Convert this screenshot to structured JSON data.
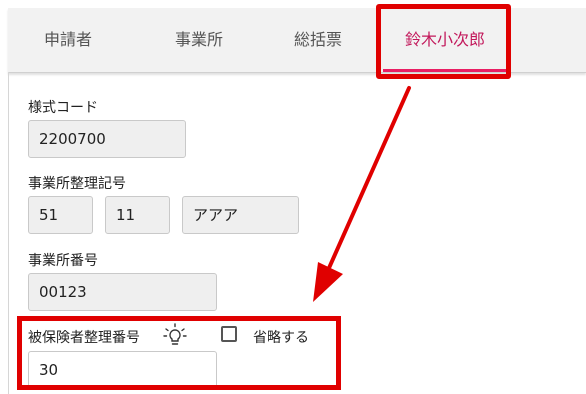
{
  "tabs": [
    {
      "label": "申請者"
    },
    {
      "label": "事業所"
    },
    {
      "label": "総括票"
    },
    {
      "label": "鈴木小次郎",
      "active": true
    }
  ],
  "form": {
    "style_code": {
      "label": "様式コード",
      "value": "2200700"
    },
    "office_ref": {
      "label": "事業所整理記号",
      "values": [
        "51",
        "11",
        "アアア"
      ]
    },
    "office_number": {
      "label": "事業所番号",
      "value": "00123"
    },
    "insured_ref": {
      "label": "被保険者整理番号",
      "value": "30",
      "hint_icon": "lightbulb-icon"
    },
    "omit": {
      "label": "省略する",
      "checked": false
    }
  },
  "annotation": {
    "color": "#e00000"
  },
  "colors": {
    "accent": "#e91e63",
    "tab_bar": "#f2f2f2",
    "field_bg": "#efefef"
  }
}
